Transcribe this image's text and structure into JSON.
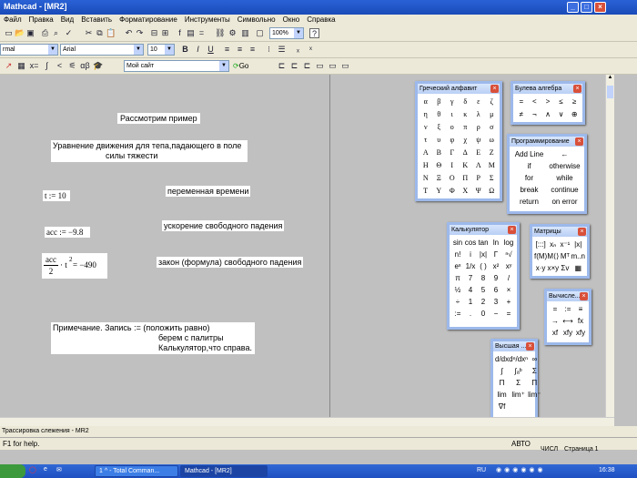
{
  "window": {
    "title": "Mathcad - [MR2]"
  },
  "menu": [
    "Файл",
    "Правка",
    "Вид",
    "Вставить",
    "Форматирование",
    "Инструменты",
    "Символьно",
    "Окно",
    "Справка"
  ],
  "toolbar2": {
    "style_combo": "rmal",
    "font_combo": "Arial",
    "size_combo": "10",
    "zoom_combo": "100%"
  },
  "toolbar3": {
    "site_combo": "Мой сайт",
    "go_label": "Go"
  },
  "doc": {
    "heading": "Рассмотрим  пример",
    "intro_line1": "Уравнение движения для тепа,падающего в поле",
    "intro_line2": "силы тяжести",
    "t_def": "t := 10",
    "t_label": "переменная времени",
    "acc_def": "acc := −9.8",
    "acc_label": "ускорение свободного падения",
    "formula_num": "acc",
    "formula_den": "2",
    "formula_rest": "· t",
    "formula_exp": "2",
    "formula_result": " = −490",
    "formula_label": "закон (формула) свободного падения",
    "note_line1": "Примечание. Запись      :=   (положить равно)",
    "note_line2": "берем с палитры",
    "note_line3": "Калькулятор,что справа."
  },
  "palettes": {
    "greek": {
      "title": "Греческий алфавит",
      "symbols": [
        "α",
        "β",
        "γ",
        "δ",
        "ε",
        "ζ",
        "η",
        "θ",
        "ι",
        "κ",
        "λ",
        "μ",
        "ν",
        "ξ",
        "ο",
        "π",
        "ρ",
        "σ",
        "τ",
        "υ",
        "φ",
        "χ",
        "ψ",
        "ω",
        "Α",
        "Β",
        "Γ",
        "Δ",
        "Ε",
        "Ζ",
        "Η",
        "Θ",
        "Ι",
        "Κ",
        "Λ",
        "Μ",
        "Ν",
        "Ξ",
        "Ο",
        "Π",
        "Ρ",
        "Σ",
        "Τ",
        "Υ",
        "Φ",
        "Χ",
        "Ψ",
        "Ω"
      ]
    },
    "boolean": {
      "title": "Булева алгебра",
      "symbols": [
        "=",
        "<",
        ">",
        "≤",
        "≥",
        "≠",
        "¬",
        "∧",
        "∨",
        "⊕"
      ]
    },
    "programming": {
      "title": "Программирование",
      "items": [
        "Add Line",
        "←",
        "if",
        "otherwise",
        "for",
        "while",
        "break",
        "continue",
        "return",
        "on error"
      ]
    },
    "calculator": {
      "title": "Калькулятор",
      "keys": [
        "sin",
        "cos",
        "tan",
        "ln",
        "log",
        "n!",
        "i",
        "|x|",
        "Γ",
        "ⁿ√",
        "eˣ",
        "1/x",
        "( )",
        "x²",
        "xʸ",
        "π",
        "7",
        "8",
        "9",
        "/",
        "½",
        "4",
        "5",
        "6",
        "×",
        "÷",
        "1",
        "2",
        "3",
        "+",
        ":=",
        ".",
        "0",
        "−",
        "="
      ]
    },
    "matrix": {
      "title": "Матрицы",
      "keys": [
        "[:::]",
        "xₙ",
        "x⁻¹",
        "|x|",
        "f(M)",
        "M⟨⟩",
        "Mᵀ",
        "m..n",
        "x·y",
        "x×y",
        "Σv",
        "▦"
      ]
    },
    "evaluation": {
      "title": "Вычисле...",
      "keys": [
        "=",
        ":=",
        "≡",
        "→",
        "⟷",
        "fx",
        "xf",
        "xfy",
        "xfy"
      ]
    },
    "calculus": {
      "title": "Высшая ...",
      "keys": [
        "d/dx",
        "dⁿ/dxⁿ",
        "∞",
        "∫",
        "∫ₐᵇ",
        "Σ",
        "Π",
        "Σ",
        "Π",
        "lim",
        "lim⁺",
        "lim⁻",
        "∇f"
      ]
    }
  },
  "tabstrip": {
    "label": "Трассировка слежения - MR2"
  },
  "statusbar": {
    "help": "F1 for help.",
    "mode": "АВТО",
    "num": "ЧИСЛ",
    "page": "Страница 1"
  },
  "taskbar": {
    "task1": "1 ^ - Total Comman...",
    "task2": "Mathcad - [MR2]",
    "lang": "RU",
    "time": "16:38"
  }
}
